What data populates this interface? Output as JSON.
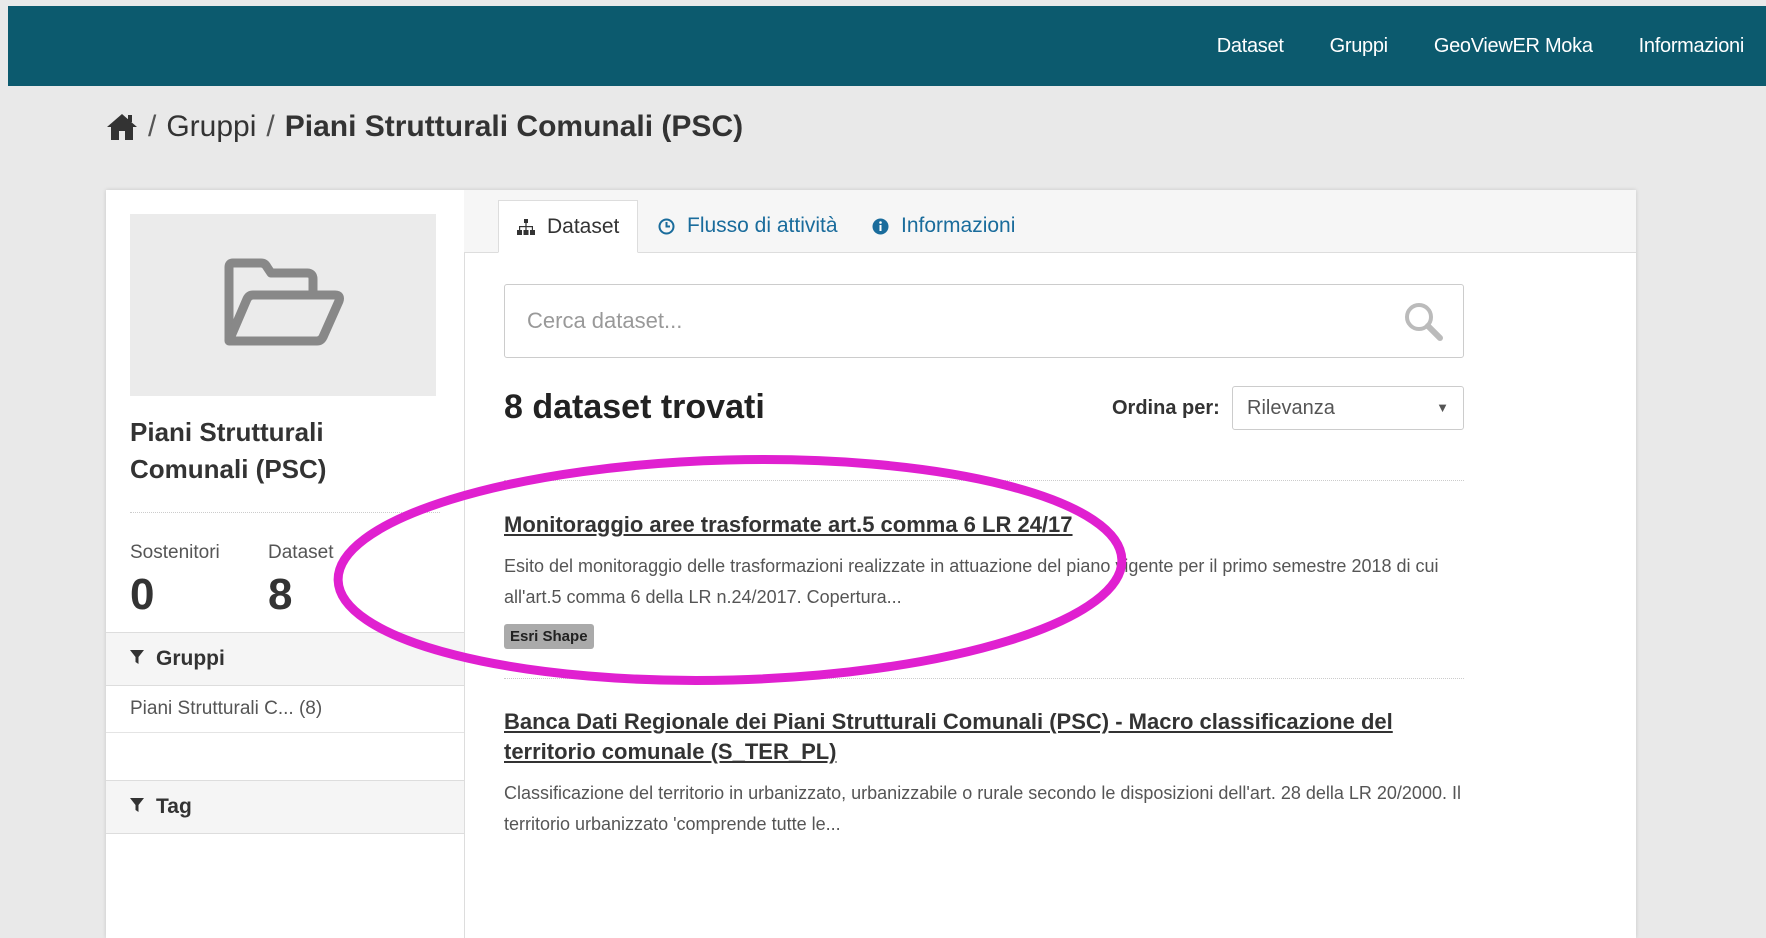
{
  "nav": {
    "items": [
      "Dataset",
      "Gruppi",
      "GeoViewER Moka",
      "Informazioni"
    ]
  },
  "breadcrumb": {
    "separator": "/",
    "parent": "Gruppi",
    "current": "Piani Strutturali Comunali (PSC)"
  },
  "sidebar": {
    "group_title": "Piani Strutturali Comunali (PSC)",
    "stats": [
      {
        "label": "Sostenitori",
        "value": "0"
      },
      {
        "label": "Dataset",
        "value": "8"
      }
    ],
    "facets": [
      {
        "title": "Gruppi",
        "items": [
          "Piani Strutturali C... (8)"
        ]
      },
      {
        "title": "Tag",
        "items": []
      }
    ]
  },
  "tabs": [
    {
      "label": "Dataset",
      "icon": "sitemap-icon"
    },
    {
      "label": "Flusso di attività",
      "icon": "clock-icon"
    },
    {
      "label": "Informazioni",
      "icon": "info-icon"
    }
  ],
  "search": {
    "placeholder": "Cerca dataset...",
    "value": ""
  },
  "results": {
    "count_text": "8 dataset trovati",
    "sort_label": "Ordina per:",
    "sort_value": "Rilevanza",
    "datasets": [
      {
        "title": "Monitoraggio aree trasformate art.5 comma 6 LR 24/17",
        "description": "Esito del monitoraggio delle trasformazioni realizzate in attuazione del piano vigente per il primo semestre 2018 di cui all'art.5 comma 6 della LR n.24/2017. Copertura...",
        "format": "Esri Shape"
      },
      {
        "title": "Banca Dati Regionale dei Piani Strutturali Comunali (PSC) - Macro classificazione del territorio comunale (S_TER_PL)",
        "description": "Classificazione del territorio in urbanizzato, urbanizzabile o rurale secondo le disposizioni dell'art. 28 della LR 20/2000. Il territorio urbanizzato 'comprende tutte le..."
      }
    ]
  },
  "colors": {
    "header": "#0c5a6e",
    "link": "#1a6c9c",
    "annotation": "#e020d0",
    "badge": "#aaaaaa"
  }
}
